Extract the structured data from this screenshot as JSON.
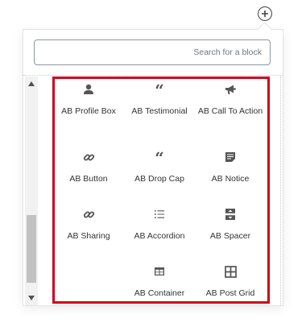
{
  "search": {
    "placeholder": "Search for a block",
    "value": ""
  },
  "blocks": [
    {
      "label": "AB Profile Box",
      "icon": "person-icon"
    },
    {
      "label": "AB Testimonial",
      "icon": "quote-icon"
    },
    {
      "label": "AB Call To Action",
      "icon": "megaphone-icon"
    },
    {
      "label": "AB Button",
      "icon": "link-icon"
    },
    {
      "label": "AB Drop Cap",
      "icon": "quote-icon"
    },
    {
      "label": "AB Notice",
      "icon": "note-icon"
    },
    {
      "label": "AB Sharing",
      "icon": "link-icon"
    },
    {
      "label": "AB Accordion",
      "icon": "list-icon"
    },
    {
      "label": "AB Spacer",
      "icon": "spacer-icon"
    },
    {
      "label": "AB Container",
      "icon": "table-icon"
    },
    {
      "label": "AB Post Grid",
      "icon": "grid-icon"
    }
  ],
  "colors": {
    "highlight": "#d0021b",
    "icon": "#555555",
    "text": "#333333"
  },
  "quote_glyph": "“"
}
